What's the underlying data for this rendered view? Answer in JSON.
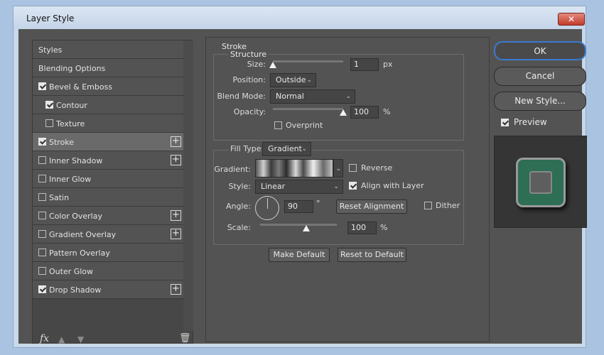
{
  "window": {
    "title": "Layer Style",
    "close_label": "✕"
  },
  "styles": {
    "items": [
      {
        "label": "Styles",
        "checkbox": false,
        "checked": false,
        "plus": false,
        "indent": false,
        "selected": false
      },
      {
        "label": "Blending Options",
        "checkbox": false,
        "checked": false,
        "plus": false,
        "indent": false,
        "selected": false
      },
      {
        "label": "Bevel & Emboss",
        "checkbox": true,
        "checked": true,
        "plus": false,
        "indent": false,
        "selected": false
      },
      {
        "label": "Contour",
        "checkbox": true,
        "checked": true,
        "plus": false,
        "indent": true,
        "selected": false
      },
      {
        "label": "Texture",
        "checkbox": true,
        "checked": false,
        "plus": false,
        "indent": true,
        "selected": false
      },
      {
        "label": "Stroke",
        "checkbox": true,
        "checked": true,
        "plus": true,
        "indent": false,
        "selected": true
      },
      {
        "label": "Inner Shadow",
        "checkbox": true,
        "checked": false,
        "plus": true,
        "indent": false,
        "selected": false
      },
      {
        "label": "Inner Glow",
        "checkbox": true,
        "checked": false,
        "plus": false,
        "indent": false,
        "selected": false
      },
      {
        "label": "Satin",
        "checkbox": true,
        "checked": false,
        "plus": false,
        "indent": false,
        "selected": false
      },
      {
        "label": "Color Overlay",
        "checkbox": true,
        "checked": false,
        "plus": true,
        "indent": false,
        "selected": false
      },
      {
        "label": "Gradient Overlay",
        "checkbox": true,
        "checked": false,
        "plus": true,
        "indent": false,
        "selected": false
      },
      {
        "label": "Pattern Overlay",
        "checkbox": true,
        "checked": false,
        "plus": false,
        "indent": false,
        "selected": false
      },
      {
        "label": "Outer Glow",
        "checkbox": true,
        "checked": false,
        "plus": false,
        "indent": false,
        "selected": false
      },
      {
        "label": "Drop Shadow",
        "checkbox": true,
        "checked": true,
        "plus": true,
        "indent": false,
        "selected": false
      }
    ],
    "plus_symbol": "+",
    "fx_label": "fx",
    "up_icon": "arrow-up-icon",
    "down_icon": "arrow-down-icon",
    "trash_icon": "trash-icon"
  },
  "stroke": {
    "heading": "Stroke",
    "structure": {
      "title": "Structure",
      "size_label": "Size:",
      "size_value": "1",
      "size_unit": "px",
      "size_level": 0.0,
      "position_label": "Position:",
      "position_value": "Outside",
      "blend_label": "Blend Mode:",
      "blend_value": "Normal",
      "opacity_label": "Opacity:",
      "opacity_value": "100",
      "opacity_unit": "%",
      "opacity_level": 1.0,
      "overprint_label": "Overprint",
      "overprint_checked": false
    },
    "fill": {
      "type_label": "Fill Type:",
      "type_value": "Gradient",
      "gradient_label": "Gradient:",
      "reverse_label": "Reverse",
      "reverse_checked": false,
      "style_label": "Style:",
      "style_value": "Linear",
      "align_label": "Align with Layer",
      "align_checked": true,
      "angle_label": "Angle:",
      "angle_value": "90",
      "angle_unit": "°",
      "reset_alignment_label": "Reset Alignment",
      "dither_label": "Dither",
      "dither_checked": false,
      "scale_label": "Scale:",
      "scale_value": "100",
      "scale_unit": "%",
      "scale_level": 0.6
    },
    "make_default_label": "Make Default",
    "reset_default_label": "Reset to Default"
  },
  "actions": {
    "ok_label": "OK",
    "cancel_label": "Cancel",
    "new_style_label": "New Style...",
    "preview_label": "Preview",
    "preview_checked": true
  },
  "colors": {
    "panel": "#535353",
    "accent": "#3a7ad0",
    "preview_green": "#2d6e55"
  }
}
